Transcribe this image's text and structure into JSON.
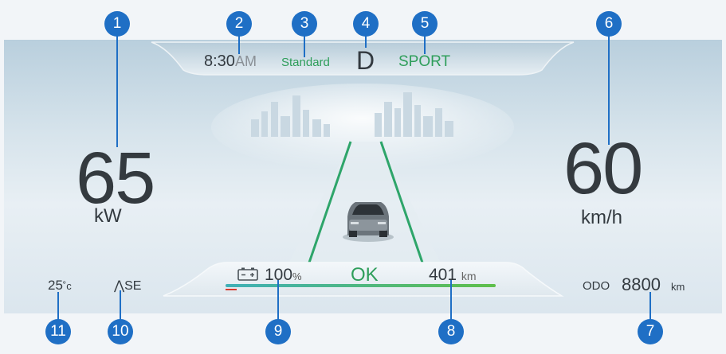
{
  "power": {
    "value": "65",
    "unit": "kW"
  },
  "speed": {
    "value": "60",
    "unit": "km/h"
  },
  "top_bar": {
    "time": "8:30",
    "time_suffix": "AM",
    "drive_mode": "Standard",
    "gear": "D",
    "sport_mode": "SPORT"
  },
  "bottom_bar": {
    "battery_percent": "100",
    "battery_unit": "%",
    "battery_fraction": 1.0,
    "status": "OK",
    "range_value": "401",
    "range_unit": "km"
  },
  "environment": {
    "temperature": "25",
    "temperature_unit": "˚c",
    "heading": "SE"
  },
  "odometer": {
    "label": "ODO",
    "value": "8800",
    "unit": "km"
  },
  "callouts": [
    "1",
    "2",
    "3",
    "4",
    "5",
    "6",
    "7",
    "8",
    "9",
    "10",
    "11"
  ],
  "icons": [
    "battery-icon",
    "compass-arrow-icon",
    "car-icon",
    "skyline-graphic",
    "road-lanes-graphic"
  ],
  "colors": {
    "accent_green": "#2e9e5a",
    "callout_blue": "#1f6fc5",
    "text_dark": "#343a3f",
    "bar_teal": "#3fb0b8",
    "bar_green": "#5fbf4a",
    "low_red": "#d83a2e"
  }
}
